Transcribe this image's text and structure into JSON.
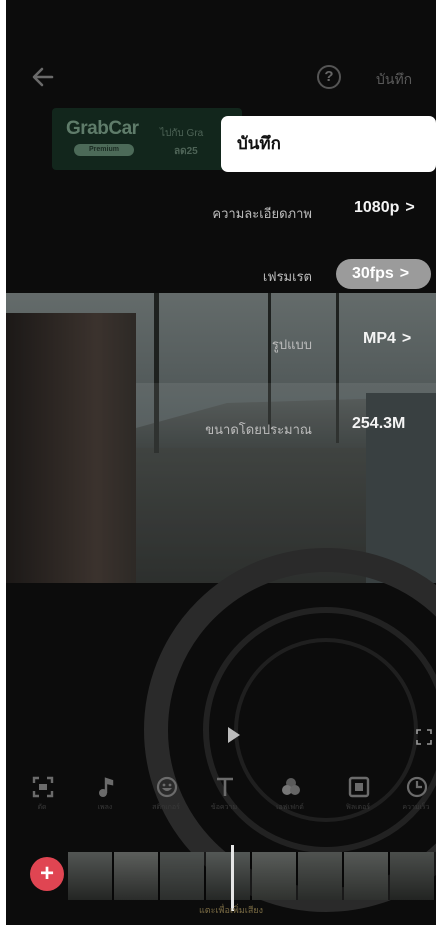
{
  "header": {
    "help_glyph": "?",
    "save_label": "บันทึก"
  },
  "ad": {
    "brand": "GrabCar",
    "tag": "Premium",
    "line1": "ไปกับ Gra",
    "line2": "ลด25"
  },
  "save_popup": {
    "label": "บันทึก"
  },
  "settings": {
    "resolution": {
      "label": "ความละเอียดภาพ",
      "value": "1080p"
    },
    "frame_rate": {
      "label": "เฟรมเรต",
      "value": "30fps"
    },
    "format": {
      "label": "รูปแบบ",
      "value": "MP4"
    },
    "size": {
      "label": "ขนาดโดยประมาณ",
      "value": "254.3M"
    }
  },
  "toolbar": {
    "items": [
      {
        "icon": "crop-icon",
        "label": "ตัด"
      },
      {
        "icon": "music-icon",
        "label": "เพลง"
      },
      {
        "icon": "sticker-icon",
        "label": "สติกเกอร์"
      },
      {
        "icon": "text-icon",
        "label": "ข้อความ"
      },
      {
        "icon": "effects-icon",
        "label": "เอฟเฟกต์"
      },
      {
        "icon": "filter-icon",
        "label": "ฟิลเตอร์"
      },
      {
        "icon": "clock-icon",
        "label": "ความเร็ว"
      }
    ]
  },
  "timeline": {
    "add_glyph": "+",
    "caption": "แตะเพื่อเพิ่มเสียง"
  },
  "colors": {
    "background": "#0c0c0c",
    "accent": "#e04552",
    "popup": "#ffffff"
  }
}
